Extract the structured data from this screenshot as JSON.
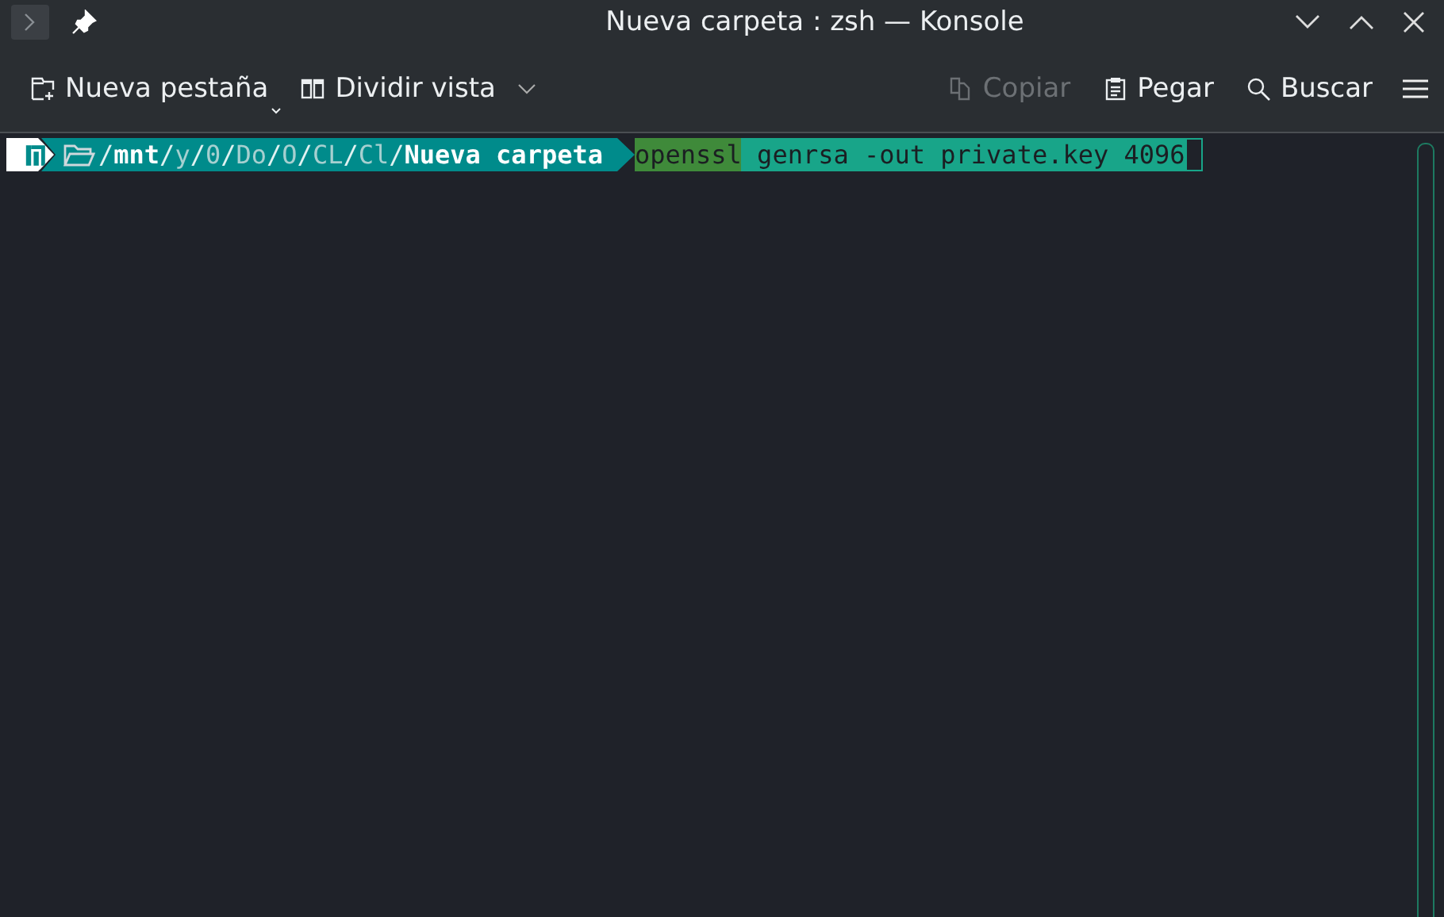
{
  "window": {
    "title": "Nueva carpeta : zsh — Konsole"
  },
  "toolbar": [
    {
      "label": "Nueva pestaña",
      "disabled": false
    },
    {
      "label": "Dividir vista",
      "disabled": false
    },
    {
      "label": "Copiar",
      "disabled": true
    },
    {
      "label": "Pegar",
      "disabled": false
    },
    {
      "label": "Buscar",
      "disabled": false
    }
  ],
  "terminal": {
    "path": [
      {
        "text": "/",
        "kind": "sep"
      },
      {
        "text": "mnt",
        "kind": "anchor"
      },
      {
        "text": "/",
        "kind": "sep"
      },
      {
        "text": "y",
        "kind": "dim"
      },
      {
        "text": "/",
        "kind": "sep"
      },
      {
        "text": "0",
        "kind": "dim"
      },
      {
        "text": "/",
        "kind": "sep"
      },
      {
        "text": "Do",
        "kind": "dim"
      },
      {
        "text": "/",
        "kind": "sep"
      },
      {
        "text": "O",
        "kind": "dim"
      },
      {
        "text": "/",
        "kind": "sep"
      },
      {
        "text": "CL",
        "kind": "dim"
      },
      {
        "text": "/",
        "kind": "sep"
      },
      {
        "text": "Cl",
        "kind": "dim"
      },
      {
        "text": "/",
        "kind": "sep"
      },
      {
        "text": "Nueva carpeta",
        "kind": "anchor"
      }
    ],
    "command": [
      {
        "text": "openssl",
        "kind": "command"
      },
      {
        "text": " genrsa -out private.key 4096",
        "kind": "args"
      }
    ]
  }
}
